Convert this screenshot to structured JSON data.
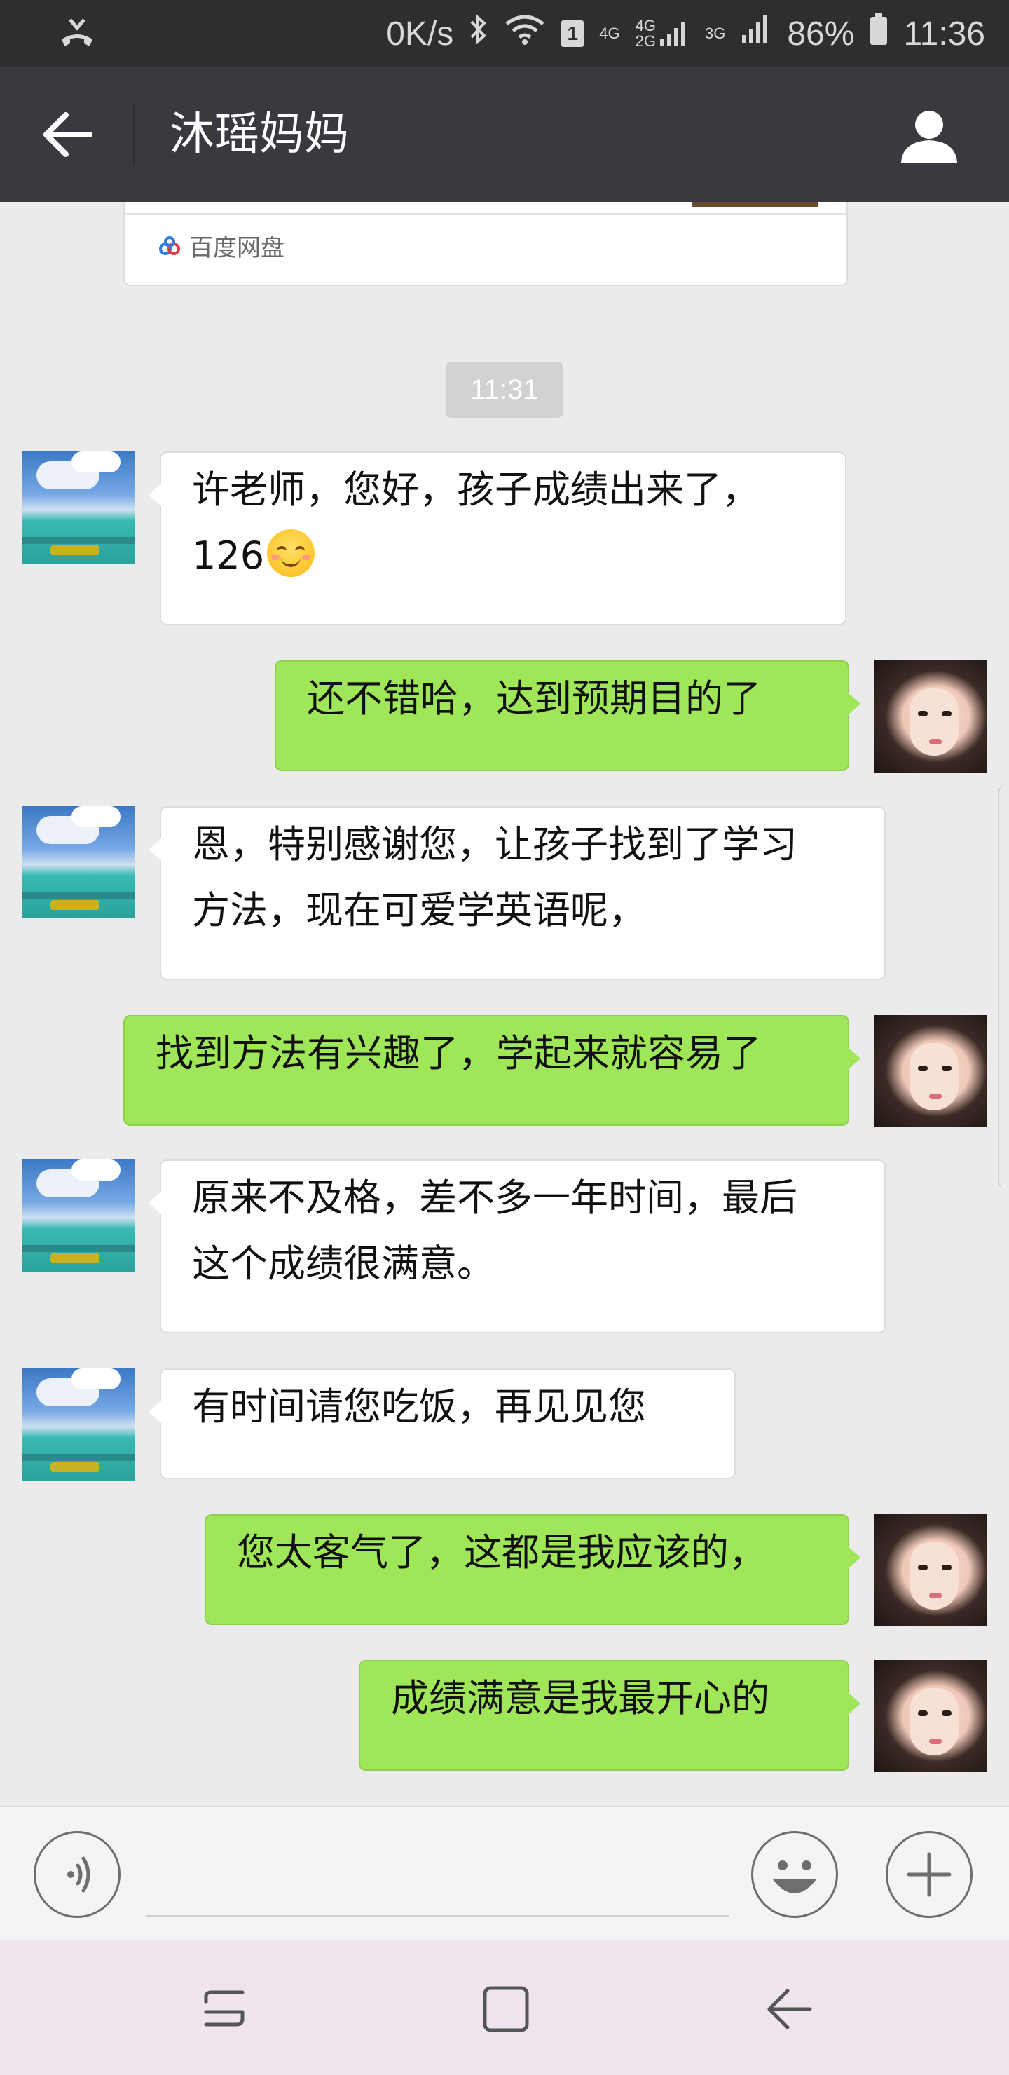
{
  "status_bar": {
    "speed": "0K/s",
    "sim_badge": "1",
    "net_4g": "4G",
    "net_4g2g_top": "4G",
    "net_4g2g_bottom": "2G",
    "net_3g": "3G",
    "battery": "86%",
    "time": "11:36"
  },
  "title_bar": {
    "title": "沐瑶妈妈"
  },
  "link_card": {
    "source": "百度网盘"
  },
  "timestamp": "11:31",
  "messages": [
    {
      "sender": "other",
      "lines": [
        "许老师，您好，孩子成绩出来了，",
        "126"
      ],
      "emoji": "smiling-face"
    },
    {
      "sender": "me",
      "text": "还不错哈，达到预期目的了"
    },
    {
      "sender": "other",
      "lines": [
        "恩，特别感谢您，让孩子找到了学习",
        "方法，现在可爱学英语呢，"
      ]
    },
    {
      "sender": "me",
      "text": "找到方法有兴趣了，学起来就容易了"
    },
    {
      "sender": "other",
      "lines": [
        "原来不及格，差不多一年时间，最后",
        "这个成绩很满意。"
      ]
    },
    {
      "sender": "other",
      "text": "有时间请您吃饭，再见见您"
    },
    {
      "sender": "me",
      "text": "您太客气了，这都是我应该的，"
    },
    {
      "sender": "me",
      "text": "成绩满意是我最开心的"
    }
  ],
  "icons": {
    "status_left": "call-icon",
    "back": "back-arrow-icon",
    "profile": "person-icon",
    "voice": "voice-icon",
    "emoji": "emoji-icon",
    "plus": "plus-icon",
    "nav_recent": "recent-apps-icon",
    "nav_home": "home-icon",
    "nav_back": "nav-back-icon"
  },
  "colors": {
    "sent_bubble": "#9fe658",
    "received_bubble": "#ffffff",
    "title_bar": "#393a3f",
    "background": "#ebebeb"
  }
}
